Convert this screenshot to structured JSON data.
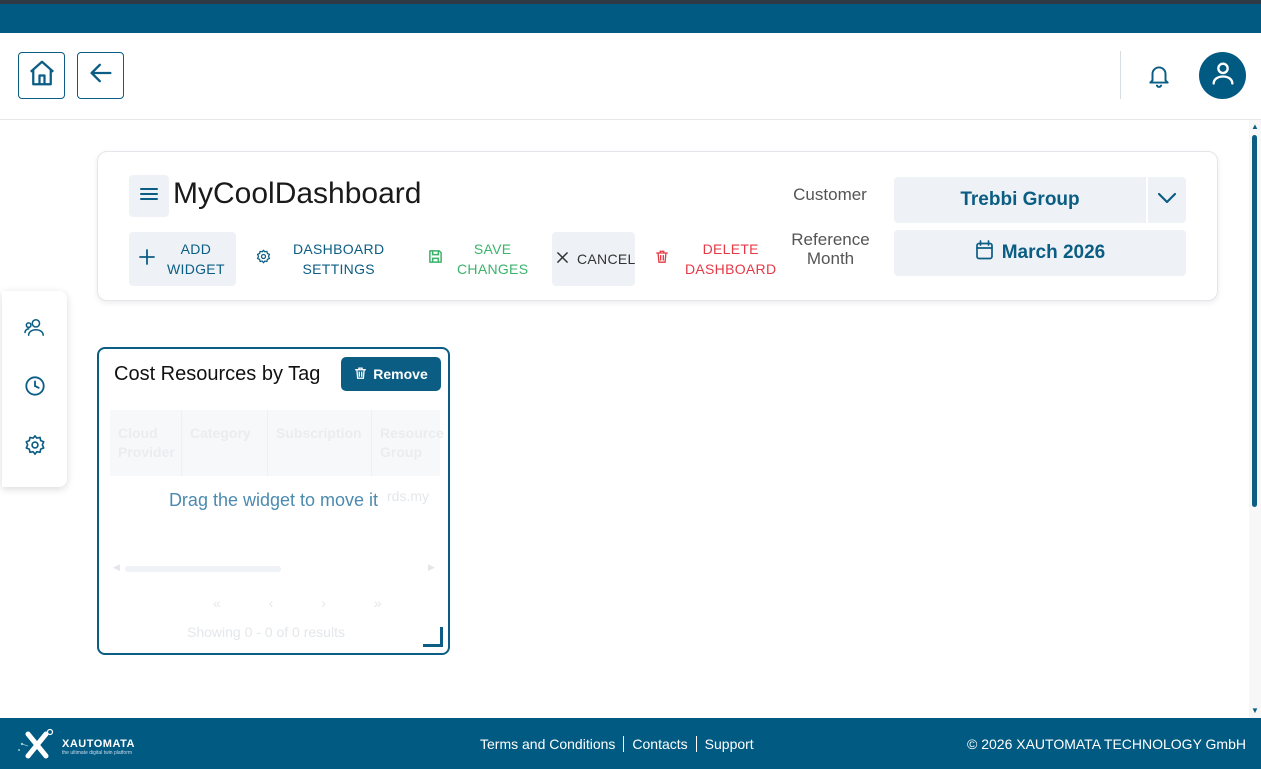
{
  "header": {
    "home_label": "home",
    "back_label": "back"
  },
  "dashboard": {
    "title": "MyCoolDashboard",
    "actions": {
      "add_widget": [
        "ADD",
        "WIDGET"
      ],
      "settings": [
        "DASHBOARD",
        "SETTINGS"
      ],
      "save": [
        "SAVE",
        "CHANGES"
      ],
      "cancel": "CANCEL",
      "delete": [
        "DELETE",
        "DASHBOARD"
      ]
    },
    "customer_label": "Customer",
    "customer_value": "Trebbi Group",
    "reference_month_label": [
      "Reference",
      "Month"
    ],
    "reference_month_value": "March 2026"
  },
  "widget": {
    "title": "Cost Resources by Tag",
    "remove_label": "Remove",
    "columns": [
      "Cloud Provider",
      "Category",
      "Subscription",
      "Resource Group"
    ],
    "drag_hint": "Drag the widget to move it",
    "ghost_row_text": "rds.my",
    "ghost_pager": "« ‹ › »",
    "ghost_results": "Showing 0 - 0 of 0 results"
  },
  "footer": {
    "brand": "XAUTOMATA",
    "tagline": "the ultimate digital twin platform",
    "links": [
      "Terms and Conditions",
      "Contacts",
      "Support"
    ],
    "copyright": "© 2026 XAUTOMATA TECHNOLOGY GmbH"
  },
  "colors": {
    "primary": "#005a82",
    "save": "#3bb36b",
    "delete": "#e53945",
    "surface": "#eef2f6"
  }
}
